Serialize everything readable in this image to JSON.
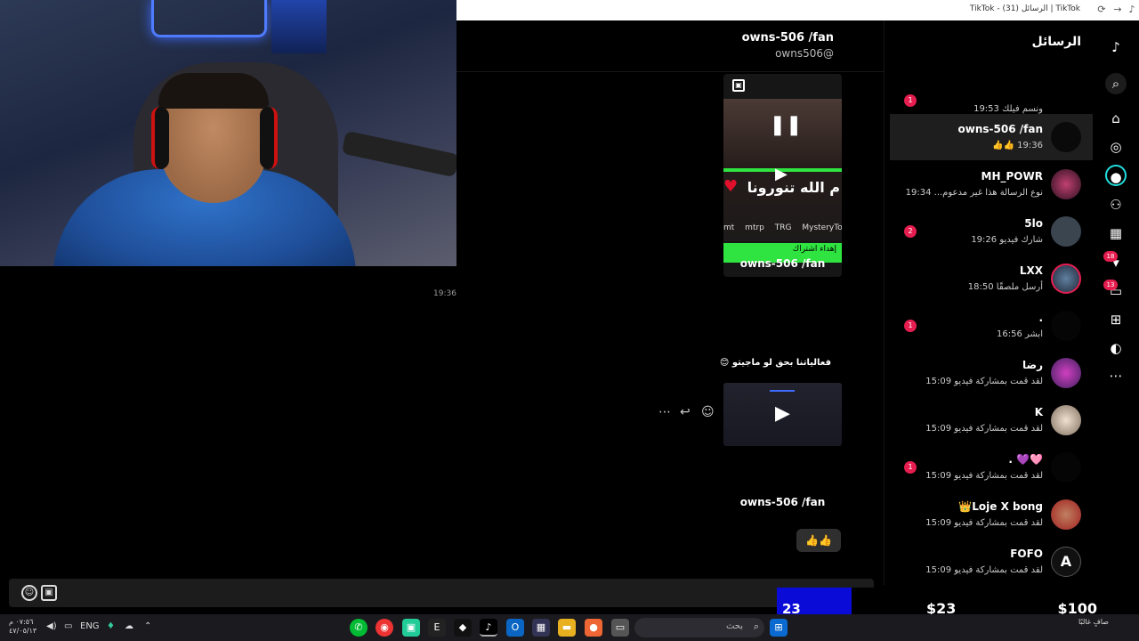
{
  "browser": {
    "tab_title": "TikTok - (31) الرسائل | TikTok"
  },
  "chat": {
    "title": "owns-506 /fan",
    "handle": "owns506@",
    "video_card": {
      "caption": "م الله تنورونا",
      "tags": [
        "MysteryTov",
        "TRG",
        "mtrp",
        "mt"
      ],
      "sub_banner": "إهداء اشتراك",
      "label": "owns-506 /fan"
    },
    "timestamp": "19:36",
    "message_text": "فعالياتنا بحق لو ماجيتو 😊",
    "shared_label": "owns-506 /fan",
    "emoji_reply": "👍👍"
  },
  "list": {
    "title": "الرسائل",
    "conversations": [
      {
        "name": "",
        "preview": "ونسم فيلك 19:53",
        "badge": "1"
      },
      {
        "name": "owns-506 /fan",
        "preview": "19:36 👍👍",
        "badge": ""
      },
      {
        "name": "MH_POWR",
        "preview": "نوع الرسالة هذا غير مدعوم... 19:34",
        "badge": ""
      },
      {
        "name": "5lo",
        "preview": "شارك فيديو 19:26",
        "badge": "2"
      },
      {
        "name": "LXX",
        "preview": "أرسل ملصقًا 18:50",
        "badge": ""
      },
      {
        "name": ".",
        "preview": "ابشر 16:56",
        "badge": "1"
      },
      {
        "name": "رضا",
        "preview": "لقد قمت بمشاركة فيديو 15:09",
        "badge": ""
      },
      {
        "name": "K",
        "preview": "لقد قمت بمشاركة فيديو 15:09",
        "badge": ""
      },
      {
        "name": ". 💜🩷",
        "preview": "لقد قمت بمشاركة فيديو 15:09",
        "badge": "1"
      },
      {
        "name": "👑Loje X bong",
        "preview": "لقد قمت بمشاركة فيديو 15:09",
        "badge": ""
      },
      {
        "name": "FOFO",
        "preview": "لقد قمت بمشاركة فيديو 15:09",
        "badge": ""
      }
    ]
  },
  "rail": {
    "badges": {
      "friends": "18",
      "messages": "13"
    }
  },
  "donation": {
    "count": "23",
    "amount_current": "$23",
    "amount_goal": "$100"
  },
  "taskbar": {
    "time": "٠٧:٥٦ م",
    "date": "٤٧/٠٥/١٣",
    "lang": "ENG",
    "search_placeholder": "بحث",
    "weather": "صافٍ غالبًا"
  }
}
